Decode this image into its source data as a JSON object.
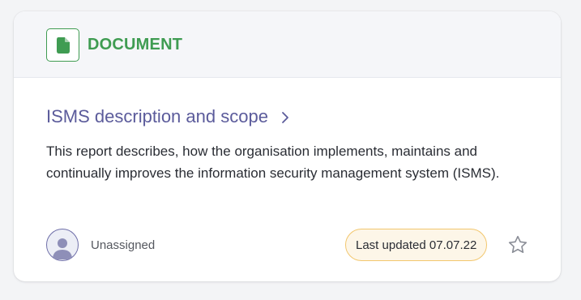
{
  "card": {
    "type_label": "DOCUMENT",
    "type_icon": "document-icon",
    "title": "ISMS description and scope",
    "title_chevron_icon": "chevron-right-icon",
    "description": "This report describes, how the organisation implements, maintains and continually improves the information security management system (ISMS).",
    "assignee": {
      "avatar_icon": "user-avatar-icon",
      "label": "Unassigned"
    },
    "last_updated": "Last updated 07.07.22",
    "favorite_icon": "star-icon"
  },
  "colors": {
    "type_accent": "#3f9c52",
    "title": "#5b5b9b",
    "badge_border": "#f2c66d",
    "badge_background": "#fdf6e8"
  }
}
